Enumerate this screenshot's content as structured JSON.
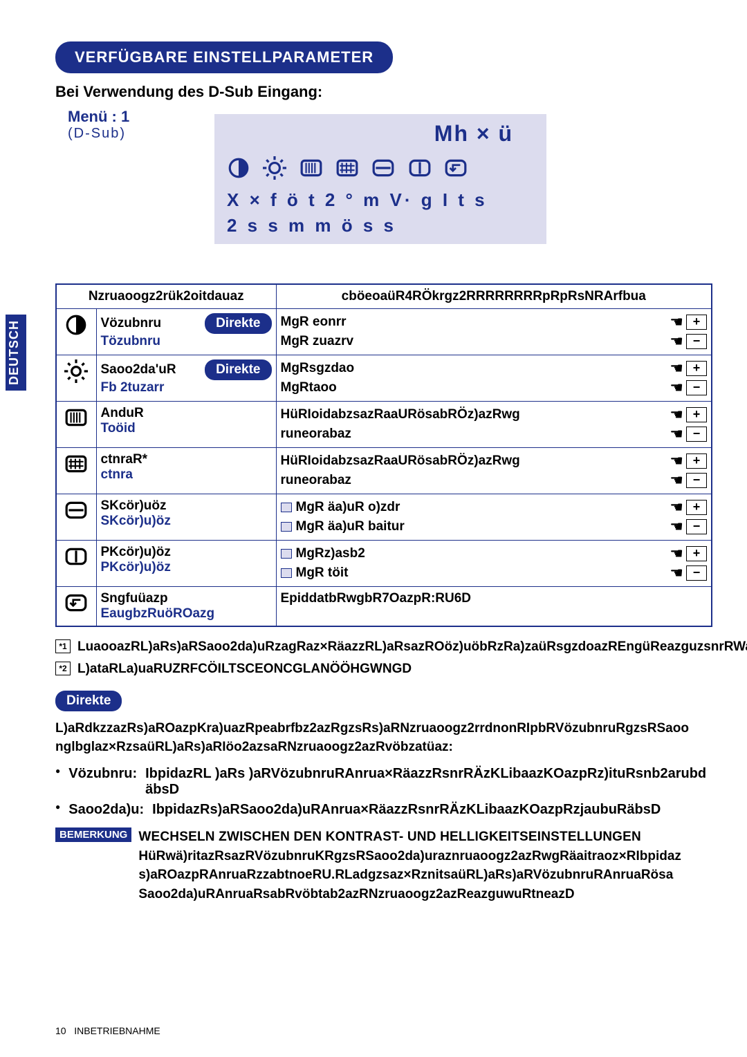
{
  "language_tab": "DEUTSCH",
  "title": "VERFÜGBARE EINSTELLPARAMETER",
  "subtitle": "Bei Verwendung des D-Sub Eingang:",
  "menu": {
    "line1": "Menü : 1",
    "line2": "(D-Sub)"
  },
  "screen": {
    "title": "Mh    × ü",
    "line1": "X × f ö t 2 ° m V· g I t s",
    "line2": "2 s s m  m ö s s"
  },
  "table": {
    "head_left": "Nzruaoogz2rük2oitdauaz",
    "head_right": "cböeoaüR4RÖkrgz2RRRRRRRRpRpRsNRArfbua",
    "rows": [
      {
        "icon": "contrast-icon",
        "name_top": "Vözubnru",
        "name_bottom": "Tözubnru",
        "direkte": true,
        "desc": [
          {
            "text": "MgR eonrr",
            "plus": true
          },
          {
            "text": "MgR zuazrv",
            "minus": true
          }
        ]
      },
      {
        "icon": "brightness-icon",
        "name_top": "Saoo2da'uR",
        "dagger": true,
        "name_bottom": "Fb 2tuzarr",
        "direkte": true,
        "desc": [
          {
            "text": "MgRsgzdao",
            "plus": true
          },
          {
            "text": "MgRtaoo",
            "minus": true
          }
        ]
      },
      {
        "icon": "hstripe-icon",
        "name_top": "AnduR",
        "name_bottom": "Toöid",
        "desc": [
          {
            "text": "HüRIoidabzsazRaaURösabRÖz)azRwg",
            "plus": true
          },
          {
            "text": "runeorabaz",
            "minus": true
          }
        ]
      },
      {
        "icon": "grid-icon",
        "name_top": "ctnraR*",
        "name_bottom": "ctnra",
        "desc": [
          {
            "text": "HüRIoidabzsazRaaURösabRÖz)azRwg",
            "plus": true
          },
          {
            "text": "runeorabaz",
            "minus": true
          }
        ]
      },
      {
        "icon": "hpos-icon",
        "name_top": "SKcör)uöz",
        "name_bottom": "SKcör)u)öz",
        "desc": [
          {
            "text": "MgR äa)uR o)zdr",
            "swatch": true,
            "plus": true
          },
          {
            "text": "MgR äa)uR baitur",
            "swatch": true,
            "minus": true
          }
        ]
      },
      {
        "icon": "vpos-icon",
        "name_top": "PKcör)u)öz",
        "name_bottom": "PKcör)u)öz",
        "desc": [
          {
            "text": "MgRz)asb2",
            "swatch": true,
            "plus": true
          },
          {
            "text": "MgR töit",
            "swatch": true,
            "minus": true
          }
        ]
      },
      {
        "icon": "return-icon",
        "name_top": "Sngfuüazp",
        "name_bottom": "EaugbzRuöROazg",
        "desc_single": "EpiddatbRwgbR7OazpR:RU6D"
      }
    ]
  },
  "fn1": "LuaooazRL)aRs)aRSaoo2da)uRzagRaz×RäazzRL)aRsazROöz)uöbRzRa)zaüRsgzdoazREngüReazguzsnrRWaIptoRtneazRsnrRs)arabRwgRtaooRäbduD",
  "fn2": "L)ataRLa)uaRUZRFCÖILTSCEONCGLANÖÖHGWNGD",
  "direkte_body": "L)aRdkzzazRs)aROazpKra)uazRpeabrfbz2azRgzsRs)aRNzruaoogz2rrdnonRIpbRVözubnruRgzsRSaoo nglbglaz×RzsaüRL)aRs)aRIöo2azsaRNzruaoogz2azRvöbzatüaz:",
  "bullets": {
    "kontrast_label": "Vözubnru:",
    "kontrast_text": "IbpidazRL )aRs )aRVözubnruRAnrua×RäazzRsnrRÄzKLibaazKOazpRz)ituRsnb2arubd äbsD",
    "helligkeit_label": "Saoo2da)u:",
    "helligkeit_text": "IbpidazRs)aRSaoo2da)uRAnrua×RäazzRsnrRÄzKLibaazKOazpRzjaubuRäbsD"
  },
  "bemerkung": {
    "label": "BEMERKUNG",
    "head": "WECHSELN ZWISCHEN DEN KONTRAST- UND HELLIGKEITSEINSTELLUNGEN",
    "body1": "HüRwä)ritazRsazRVözubnruKRgzsRSaoo2da)uraznruaoogz2azRwgRäaitraoz×RIbpidaz",
    "body2": "s)aROazpRAnruaRzzabtnoeRU.RLadgzsaz×RznitsaüRL)aRs)aRVözubnruRAnruaRösa",
    "body3": "Saoo2da)uRAnruaRsabRvöbtab2azRNzruaoogz2azReazguwuRtneazD"
  },
  "footer": {
    "page": "10",
    "section": "INBETRIEBNAHME"
  }
}
